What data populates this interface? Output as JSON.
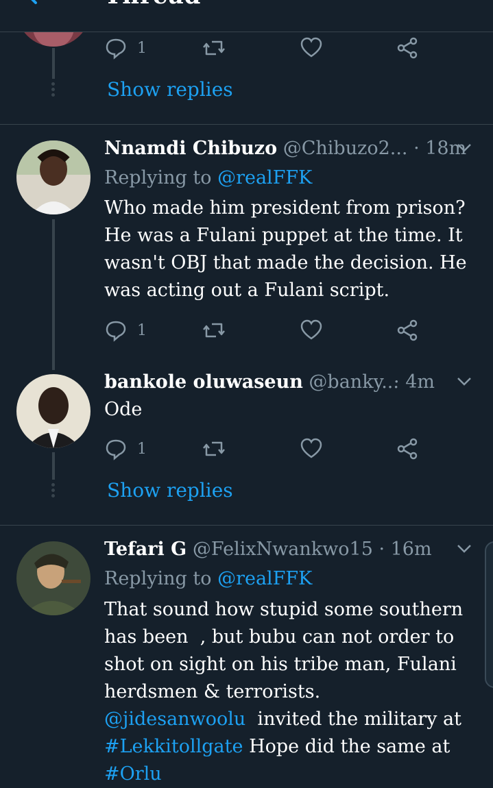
{
  "header": {
    "title": "Thread"
  },
  "top_tweet": {
    "actions": {
      "reply_count": "1",
      "retweet_count": "",
      "like_count": ""
    },
    "show_replies": "Show replies"
  },
  "tweets": [
    {
      "name": "Nnamdi Chibuzo",
      "handle": "@Chibuzo2...",
      "time": "· 18m",
      "replying_prefix": "Replying to",
      "replying_to": "@realFFK",
      "text_lines": [
        "Who made him president from prison?",
        "He was a Fulani puppet at the time. It",
        "wasn't OBJ that made the decision. He",
        "was acting out a Fulani script."
      ],
      "reply_count": "1"
    },
    {
      "name": "bankole oluwaseun",
      "handle": "@banky...",
      "time": "· 4m",
      "text": "Ode",
      "reply_count": "1",
      "show_replies": "Show replies"
    },
    {
      "name": "Tefari G",
      "handle": "@FelixNwankwo15",
      "time": "· 16m",
      "replying_prefix": "Replying to",
      "replying_to": "@realFFK",
      "text_lines": [
        "That sound how stupid some southern",
        "has been  , but bubu can not order to",
        "shot on sight on his tribe man, Fulani",
        "herdsmen & terrorists."
      ],
      "mention": "@jidesanwoolu",
      "after_mention": "  invited the military at",
      "hashtag1": "#Lekkitollgate",
      "after_hashtag1": " Hope did the same at",
      "hashtag2": "#Orlu"
    }
  ],
  "colors": {
    "background": "#15202b",
    "accent": "#1da1f2",
    "muted": "#8899a6",
    "divider": "#38444d"
  },
  "icons": [
    "back-arrow-icon",
    "reply-icon",
    "retweet-icon",
    "like-icon",
    "share-icon",
    "caret-down-icon"
  ]
}
